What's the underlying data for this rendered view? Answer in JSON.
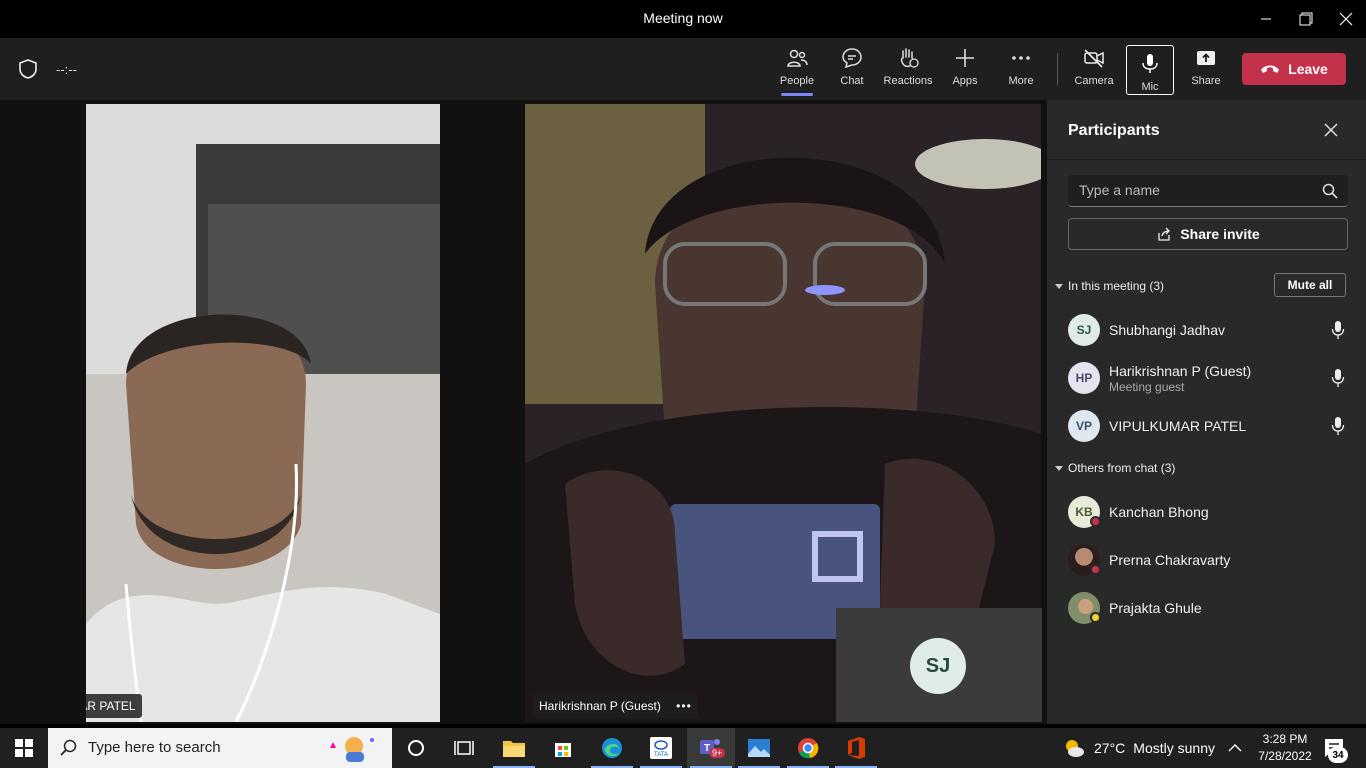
{
  "window": {
    "title": "Meeting now"
  },
  "toolbar": {
    "timer": "--:--",
    "people": "People",
    "chat": "Chat",
    "reactions": "Reactions",
    "apps": "Apps",
    "more": "More",
    "camera": "Camera",
    "mic": "Mic",
    "share": "Share",
    "leave": "Leave"
  },
  "stage": {
    "tile_left_name": "VIPULKUMAR PATEL",
    "tile_right_name": "Harikrishnan P (Guest)",
    "self_initials": "SJ"
  },
  "panel": {
    "title": "Participants",
    "search_placeholder": "Type a name",
    "share_invite": "Share invite",
    "in_meeting_header": "In this meeting (3)",
    "mute_all": "Mute all",
    "in_meeting": [
      {
        "initials": "SJ",
        "name": "Shubhangi Jadhav",
        "subtitle": ""
      },
      {
        "initials": "HP",
        "name": "Harikrishnan P (Guest)",
        "subtitle": "Meeting guest"
      },
      {
        "initials": "VP",
        "name": "VIPULKUMAR PATEL",
        "subtitle": ""
      }
    ],
    "others_header": "Others from chat (3)",
    "others": [
      {
        "initials": "KB",
        "name": "Kanchan Bhong"
      },
      {
        "initials": "",
        "name": "Prerna Chakravarty"
      },
      {
        "initials": "",
        "name": "Prajakta Ghule"
      }
    ]
  },
  "taskbar": {
    "search_placeholder": "Type here to search",
    "weather_temp": "27°C",
    "weather_text": "Mostly sunny",
    "time": "3:28 PM",
    "date": "7/28/2022",
    "teams_badge": "9+",
    "notification_count": "34"
  },
  "colors": {
    "leave": "#c4314b",
    "accent": "#7f85f5",
    "busy": "#c4314b",
    "away": "#f8d22a"
  }
}
